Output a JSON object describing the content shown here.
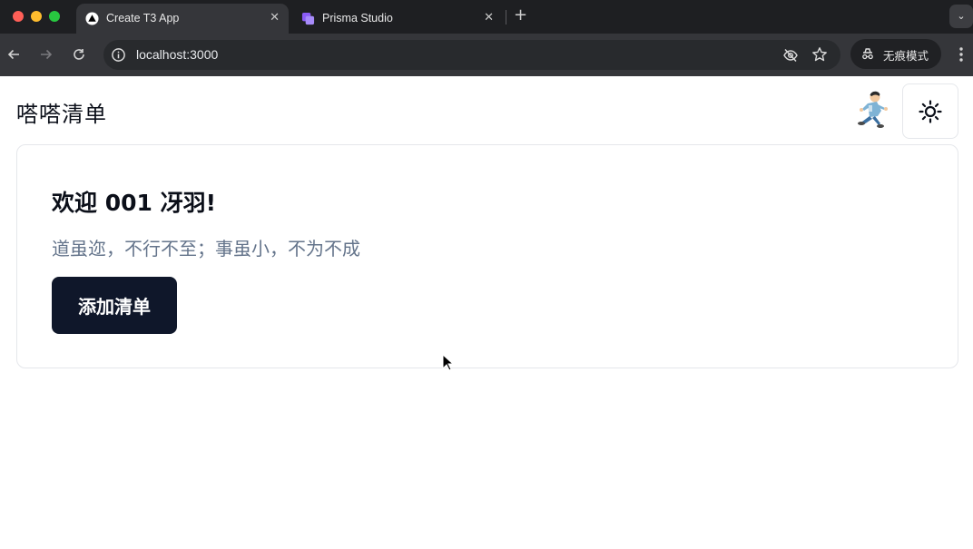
{
  "browser": {
    "tabs": [
      {
        "title": "Create T3 App",
        "active": true
      },
      {
        "title": "Prisma Studio",
        "active": false
      }
    ],
    "url": "localhost:3000",
    "incognito_label": "无痕模式"
  },
  "header": {
    "app_title": "嗒嗒清单"
  },
  "card": {
    "welcome": "欢迎 001 冴羽!",
    "motto": "道虽迩，不行不至；事虽小，不为不成",
    "add_button": "添加清单"
  },
  "colors": {
    "primary_button": "#0f172a",
    "muted_text": "#64748b",
    "border": "#e5e7eb"
  },
  "icons": {
    "theme_toggle": "sun-icon",
    "avatar": "running-character"
  }
}
